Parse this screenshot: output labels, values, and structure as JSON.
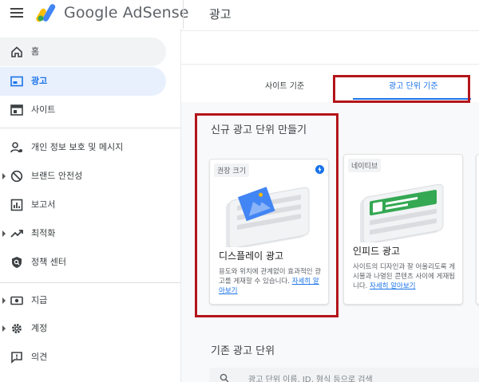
{
  "app": {
    "logo_text": "Google AdSense",
    "page_title": "광고"
  },
  "sidebar": {
    "items": [
      {
        "label": "홈",
        "icon": "home-icon"
      },
      {
        "label": "광고",
        "icon": "ads-icon",
        "active": true
      },
      {
        "label": "사이트",
        "icon": "sites-icon"
      },
      {
        "label": "개인 정보 보호 및 메시지",
        "icon": "privacy-icon"
      },
      {
        "label": "브랜드 안전성",
        "icon": "block-icon"
      },
      {
        "label": "보고서",
        "icon": "reports-icon"
      },
      {
        "label": "최적화",
        "icon": "trending-up-icon"
      },
      {
        "label": "정책 센터",
        "icon": "policy-shield-icon"
      },
      {
        "label": "지급",
        "icon": "payments-icon"
      },
      {
        "label": "계정",
        "icon": "gear-icon"
      },
      {
        "label": "의견",
        "icon": "feedback-icon"
      }
    ]
  },
  "tabs": {
    "by_site": "사이트 기준",
    "by_ad_unit": "광고 단위 기준"
  },
  "new_ad_unit": {
    "title": "신규 광고 단위 만들기",
    "display": {
      "badge": "권장 크기",
      "title": "디스플레이 광고",
      "desc": "용도와 위치에 관계없이 효과적인 광고를 게재할 수 있습니다.",
      "link": "자세히 알아보기"
    },
    "infeed": {
      "badge": "네이티브",
      "title": "인피드 광고",
      "desc": "사이트의 디자인과 잘 어울리도록 게시물과 나열된 콘텐츠 사이에 게재됩니다.",
      "link": "자세히 알아보기"
    }
  },
  "existing": {
    "title": "기존 광고 단위",
    "search_placeholder": "광고 단위 이름, ID, 형식 등으로 검색"
  },
  "colors": {
    "accent": "#1a73e8",
    "highlight": "#b3151a",
    "active_bg": "#e8f0fe"
  }
}
